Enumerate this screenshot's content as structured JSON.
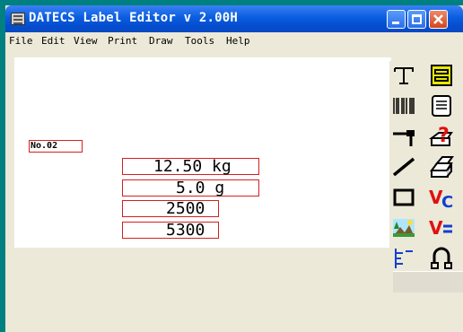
{
  "window": {
    "title": "DATECS Label Editor v 2.00H",
    "accent_color": "#0a5de0"
  },
  "menu": [
    "File",
    "Edit",
    "View",
    "Print",
    "Draw",
    "Tools",
    "Help"
  ],
  "label": {
    "id_text": "No.02",
    "fields": [
      {
        "text": "12.50 kg"
      },
      {
        "text": "5.0 g"
      },
      {
        "text": "2500"
      },
      {
        "text": "5300"
      }
    ]
  },
  "toolbox": {
    "tools": [
      {
        "name": "text-tool-icon"
      },
      {
        "name": "field-tool-icon"
      },
      {
        "name": "barcode-tool-icon"
      },
      {
        "name": "list-tool-icon"
      },
      {
        "name": "hline-tool-icon"
      },
      {
        "name": "print-help-icon"
      },
      {
        "name": "line-tool-icon"
      },
      {
        "name": "printer-icon"
      },
      {
        "name": "rectangle-tool-icon"
      },
      {
        "name": "variable-c-icon"
      },
      {
        "name": "image-tool-icon"
      },
      {
        "name": "variable-eq-icon"
      },
      {
        "name": "align-tool-icon"
      },
      {
        "name": "magnet-tool-icon"
      }
    ]
  }
}
